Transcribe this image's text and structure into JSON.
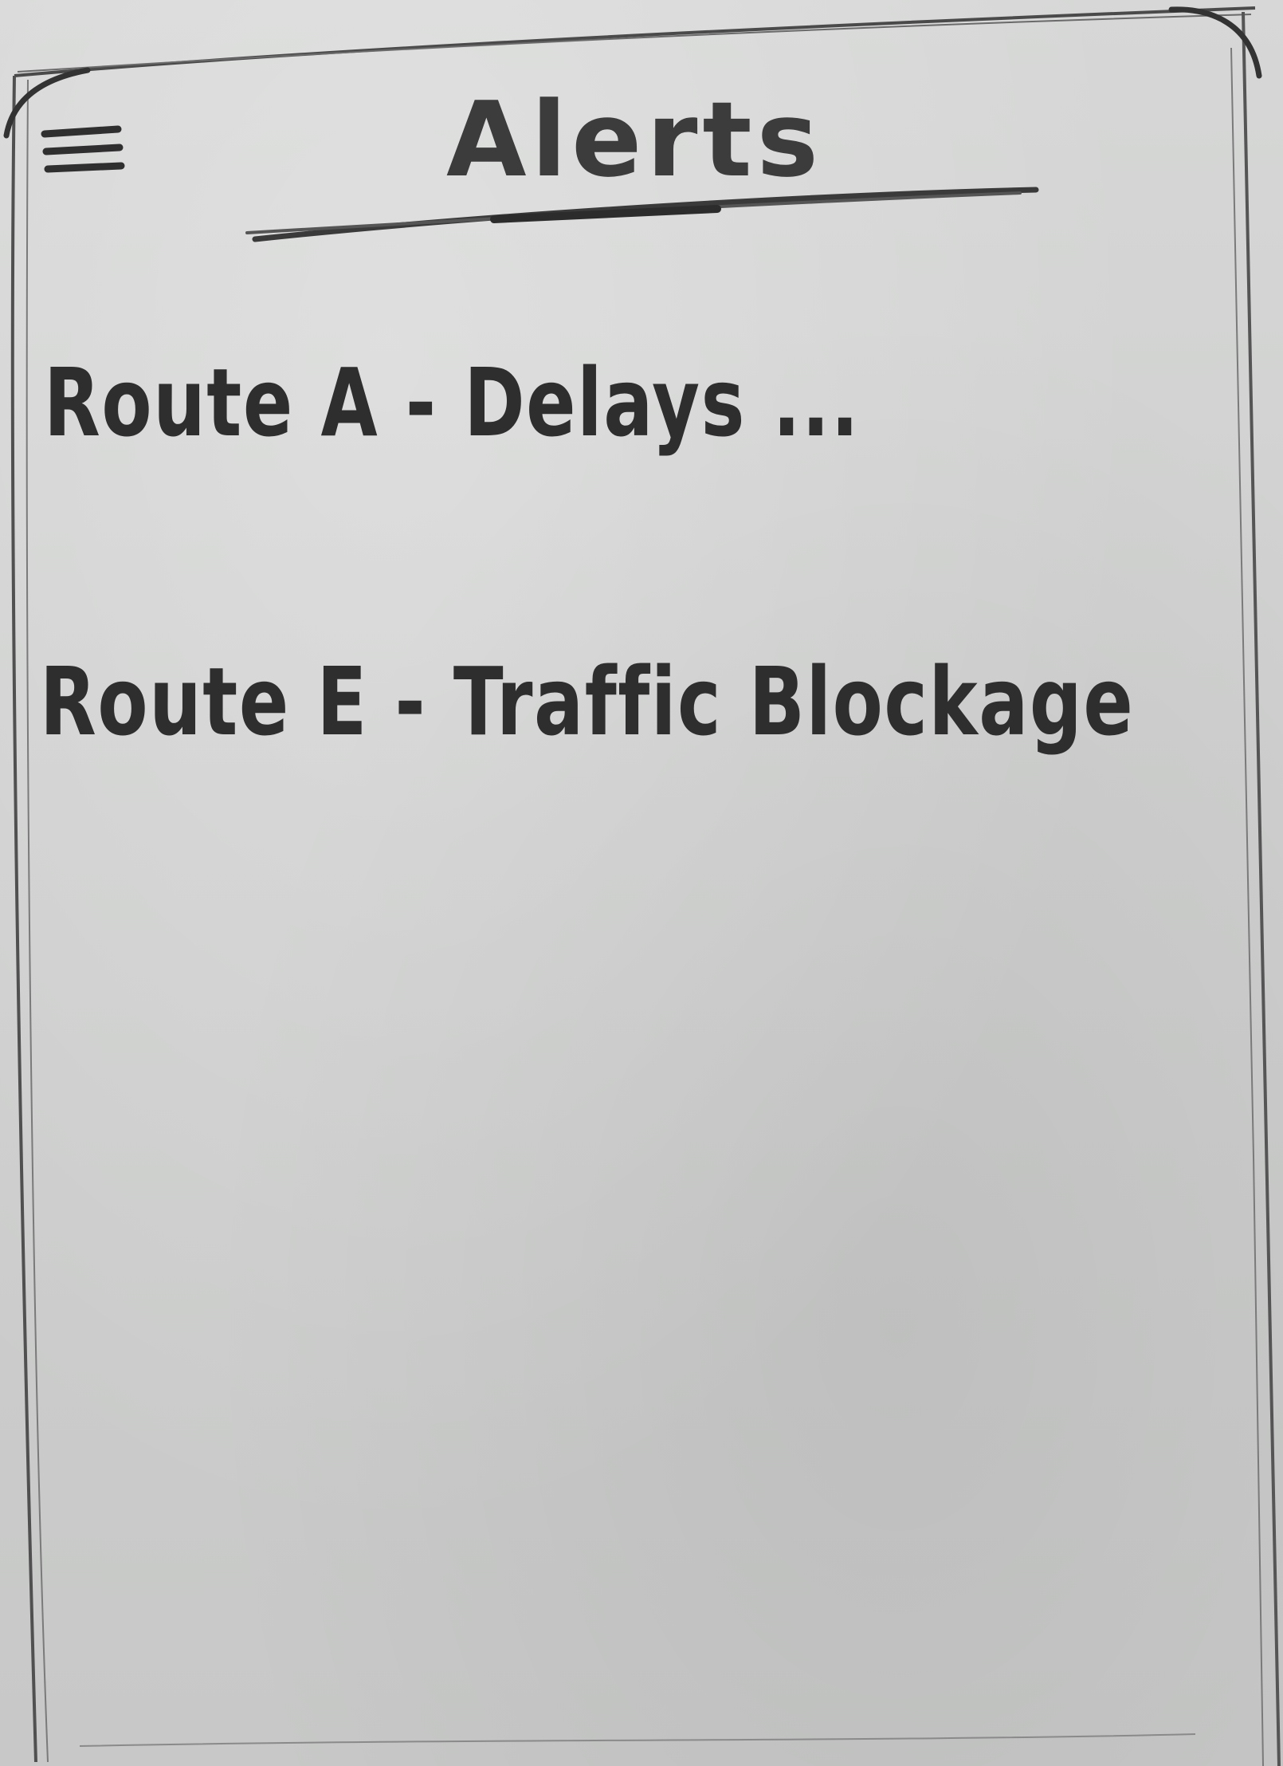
{
  "header": {
    "title": "Alerts",
    "menu_icon": "hamburger-menu-icon"
  },
  "alerts": [
    {
      "label": "Route A - Delays ..."
    },
    {
      "label": "Route E - Traffic Blockage"
    }
  ],
  "colors": {
    "paper": "#cfd0cf",
    "ink": "#333333"
  }
}
